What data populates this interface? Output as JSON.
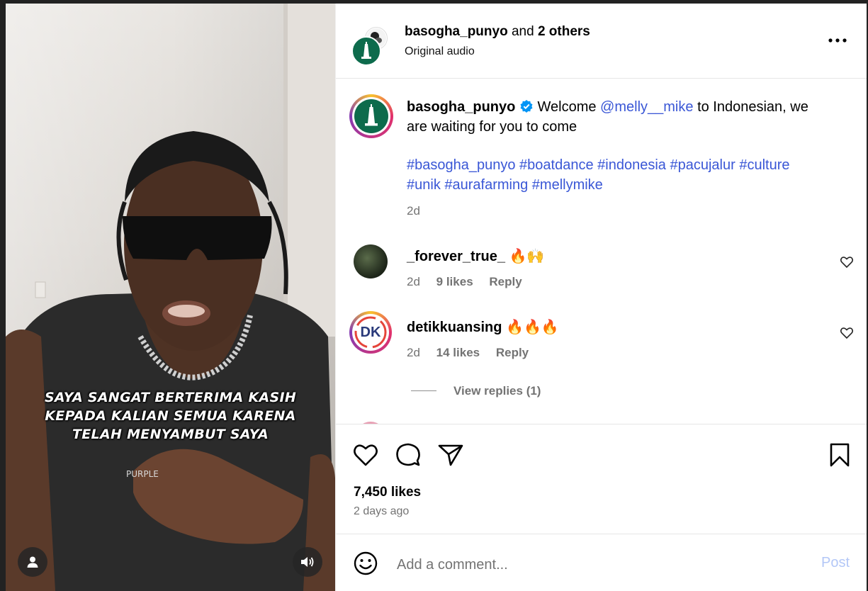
{
  "post": {
    "authors": "basogha_punyo",
    "authors_joiner": "and",
    "others": "2 others",
    "audio": "Original audio",
    "more_icon": "more-horizontal-icon"
  },
  "video": {
    "caption_lines": [
      "SAYA SANGAT BERTERIMA KASIH",
      "KEPADA KALIAN SEMUA KARENA",
      "TELAH MENYAMBUT SAYA"
    ],
    "shirt_text": "PURPLE",
    "user_icon": "person-icon",
    "sound_icon": "speaker-icon"
  },
  "caption": {
    "username": "basogha_punyo",
    "verified": true,
    "text_before": "Welcome",
    "mention": "@melly__mike",
    "text_after": "to Indonesian, we are waiting for you to come",
    "hashtags": [
      "#basogha_punyo",
      "#boatdance",
      "#indonesia",
      "#pacujalur",
      "#culture",
      "#unik",
      "#aurafarming",
      "#mellymike"
    ],
    "time": "2d"
  },
  "comments": [
    {
      "username": "_forever_true_",
      "text": "🔥🙌",
      "time": "2d",
      "likes": "9 likes",
      "reply": "Reply"
    },
    {
      "username": "detikkuansing",
      "text": "🔥🔥🔥",
      "time": "2d",
      "likes": "14 likes",
      "reply": "Reply",
      "avatar_text": "DK",
      "view_replies": "View replies (1)"
    }
  ],
  "actions": {
    "likes": "7,450 likes",
    "posted": "2 days ago"
  },
  "composer": {
    "placeholder": "Add a comment...",
    "post_label": "Post"
  },
  "colors": {
    "link": "#3a57d6",
    "verified": "#0095f6",
    "logo_green": "#0d6b4c",
    "post_disabled": "#b3c7f7"
  }
}
